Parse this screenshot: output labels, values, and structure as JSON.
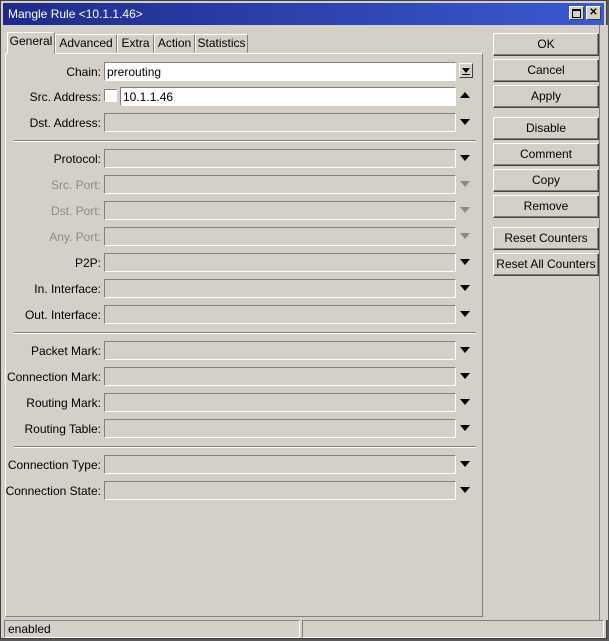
{
  "window": {
    "title": "Mangle Rule <10.1.1.46>"
  },
  "tabs": [
    {
      "label": "General"
    },
    {
      "label": "Advanced"
    },
    {
      "label": "Extra"
    },
    {
      "label": "Action"
    },
    {
      "label": "Statistics"
    }
  ],
  "fields": {
    "chain": {
      "label": "Chain:",
      "value": "prerouting"
    },
    "src_address": {
      "label": "Src. Address:",
      "value": "10.1.1.46"
    },
    "dst_address": {
      "label": "Dst. Address:",
      "value": ""
    },
    "protocol": {
      "label": "Protocol:",
      "value": ""
    },
    "src_port": {
      "label": "Src. Port:",
      "value": ""
    },
    "dst_port": {
      "label": "Dst. Port:",
      "value": ""
    },
    "any_port": {
      "label": "Any. Port:",
      "value": ""
    },
    "p2p": {
      "label": "P2P:",
      "value": ""
    },
    "in_interface": {
      "label": "In. Interface:",
      "value": ""
    },
    "out_interface": {
      "label": "Out. Interface:",
      "value": ""
    },
    "packet_mark": {
      "label": "Packet Mark:",
      "value": ""
    },
    "connection_mark": {
      "label": "Connection Mark:",
      "value": ""
    },
    "routing_mark": {
      "label": "Routing Mark:",
      "value": ""
    },
    "routing_table": {
      "label": "Routing Table:",
      "value": ""
    },
    "connection_type": {
      "label": "Connection Type:",
      "value": ""
    },
    "connection_state": {
      "label": "Connection State:",
      "value": ""
    }
  },
  "buttons": {
    "ok": "OK",
    "cancel": "Cancel",
    "apply": "Apply",
    "disable": "Disable",
    "comment": "Comment",
    "copy": "Copy",
    "remove": "Remove",
    "reset_counters": "Reset Counters",
    "reset_all_counters": "Reset All Counters"
  },
  "status": {
    "left": "enabled",
    "right": ""
  }
}
